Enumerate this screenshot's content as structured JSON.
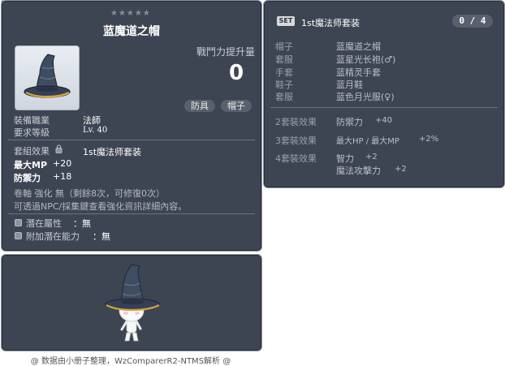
{
  "item_id": "01002152",
  "tooltip": {
    "stars": "★★★★★",
    "title": "蓝魔道之帽",
    "combat_power_label": "戰鬥力提升量",
    "combat_power_value": "0",
    "tags": [
      "防具",
      "帽子"
    ],
    "job_label": "裝備職業",
    "job_value": "法師",
    "level_label": "要求等級",
    "level_value": "Lv. 40",
    "set_effect_label": "套組效果",
    "set_effect_value": "1st魔法师套装",
    "stats": [
      {
        "name": "最大MP",
        "value": "+20"
      },
      {
        "name": "防禦力",
        "value": "+18"
      }
    ],
    "scroll_line": "卷軸 強化 無（剩餘8次，可修復0次）",
    "npc_line": "可透過NPC/採集鍵查看強化資訊詳細內容。",
    "potential_label": "潛在屬性",
    "potential_value": "：無",
    "bonus_potential_label": "附加潛在能力",
    "bonus_potential_value": "：無"
  },
  "set_panel": {
    "badge": "SET",
    "name": "1st魔法师套装",
    "count": "0 / 4",
    "items": [
      {
        "slot": "帽子",
        "name": "蓝魔道之帽"
      },
      {
        "slot": "套服",
        "name": "蓝星光长袍(♂)"
      },
      {
        "slot": "手套",
        "name": "蓝精灵手套"
      },
      {
        "slot": "鞋子",
        "name": "蓝月鞋"
      },
      {
        "slot": "套服",
        "name": "蓝色月光服(♀)"
      }
    ],
    "effects": [
      {
        "label": "2套裝效果",
        "lines": [
          {
            "stat": "防禦力",
            "value": "+40"
          }
        ]
      },
      {
        "label": "3套裝效果",
        "lines": [
          {
            "stat": "最大HP / 最大MP",
            "value": "+2%"
          }
        ]
      },
      {
        "label": "4套裝效果",
        "lines": [
          {
            "stat": "智力",
            "value": "+2"
          },
          {
            "stat": "魔法攻擊力",
            "value": "+2"
          }
        ]
      }
    ]
  },
  "footer": "@ 数据由小册子整理，WzComparerR2-NTMS解析 @",
  "colors": {
    "panel_bg": "#3e4552",
    "panel_border": "#8f96a3",
    "hat": "#3f4d62",
    "brim_gold": "#d6a534"
  },
  "icons": {
    "item_icon": "witch-hat-icon",
    "lock": "lock-icon",
    "bullet": "square-bullet-icon"
  }
}
